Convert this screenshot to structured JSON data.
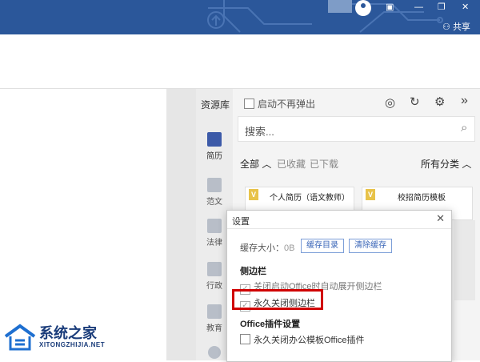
{
  "titlebar": {
    "share_label": "共享",
    "bg": "#2b579a"
  },
  "sidebar": {
    "title": "资源库",
    "items": [
      {
        "label": "简历",
        "icon": "resume-icon"
      },
      {
        "label": "范文",
        "icon": "essay-icon"
      },
      {
        "label": "法律",
        "icon": "law-icon"
      },
      {
        "label": "行政",
        "icon": "admin-icon"
      },
      {
        "label": "教育",
        "icon": "education-icon"
      }
    ]
  },
  "panel": {
    "startup_checkbox_label": "启动不再弹出",
    "search_placeholder": "搜索...",
    "filters": {
      "all": "全部",
      "collected": "已收藏",
      "downloaded": "已下载",
      "categories": "所有分类"
    },
    "cards": [
      {
        "badge": "V",
        "title": "个人简历（语文教师）"
      },
      {
        "badge": "V",
        "title": "校招简历模板"
      }
    ]
  },
  "dialog": {
    "title": "设置",
    "cache_label": "缓存大小：",
    "cache_value": "0B",
    "cache_dir_button": "缓存目录",
    "clear_cache_button": "清除缓存",
    "section_sidebar": "侧边栏",
    "option_auto_expand": "关闭启动Office时自动展开侧边栏",
    "option_close_forever": "永久关闭侧边栏",
    "section_plugin": "Office插件设置",
    "option_close_plugin": "永久关闭办公模板Office插件",
    "highlight_color": "#d00000"
  },
  "watermark": {
    "brand": "系统之家",
    "url": "XITONGZHIJIA.NET"
  }
}
